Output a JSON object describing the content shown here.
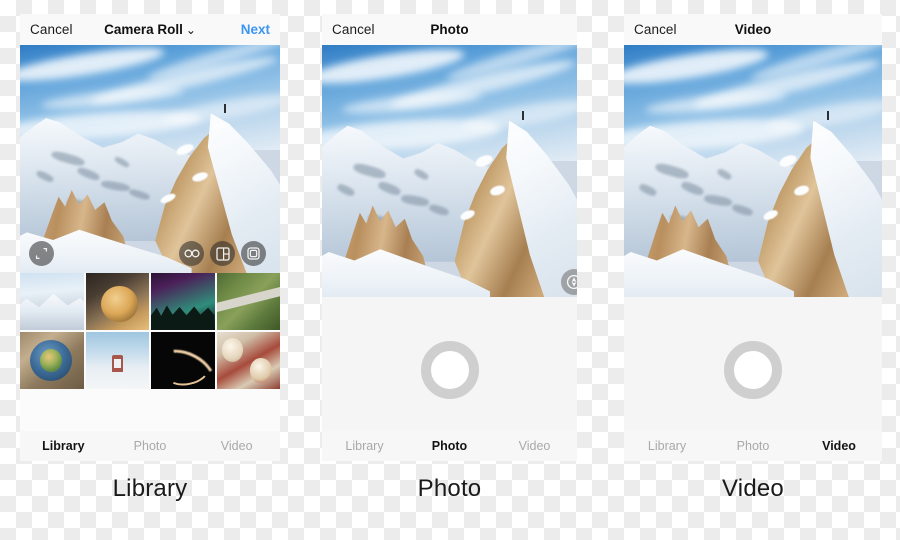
{
  "panels": [
    {
      "id": "library",
      "navbar": {
        "cancel_label": "Cancel",
        "title": "Camera Roll",
        "title_caret": "⌄",
        "next_label": "Next",
        "next_color": "#3c96f4"
      },
      "preview": {
        "alt": "snow-covered mountain peak with rocky outcrops under blue sky",
        "overlay_buttons": [
          {
            "name": "expand-icon",
            "label": "Expand"
          },
          {
            "name": "boomerang-infinity-icon",
            "label": "Boomerang"
          },
          {
            "name": "layout-icon",
            "label": "Layout"
          },
          {
            "name": "multi-select-icon",
            "label": "Select Multiple"
          }
        ]
      },
      "thumbnails": [
        {
          "name": "thumb-mountain",
          "label": "Snowy mountain"
        },
        {
          "name": "thumb-fried-food",
          "label": "Fried food on plate"
        },
        {
          "name": "thumb-aurora",
          "label": "Aurora over forest"
        },
        {
          "name": "thumb-aerial-path",
          "label": "Aerial path through field"
        },
        {
          "name": "thumb-salad-bowl",
          "label": "Salad bowl"
        },
        {
          "name": "thumb-bridge-fog",
          "label": "Bridge in fog"
        },
        {
          "name": "thumb-light-trail",
          "label": "Light trail at night"
        },
        {
          "name": "thumb-christmas",
          "label": "Christmas treats"
        }
      ],
      "tabs": [
        {
          "label": "Library",
          "active": true
        },
        {
          "label": "Photo",
          "active": false
        },
        {
          "label": "Video",
          "active": false
        }
      ],
      "caption": "Library"
    },
    {
      "id": "photo",
      "navbar": {
        "cancel_label": "Cancel",
        "title": "Photo",
        "title_caret": "",
        "next_label": "",
        "next_color": "#3c96f4"
      },
      "preview": {
        "alt": "snow-covered mountain peak with rocky outcrops under blue sky",
        "overlay_buttons": [
          {
            "name": "camera-flip-icon",
            "label": "Flip camera"
          }
        ]
      },
      "shutter": {
        "name": "shutter-button",
        "label": "Capture"
      },
      "tabs": [
        {
          "label": "Library",
          "active": false
        },
        {
          "label": "Photo",
          "active": true
        },
        {
          "label": "Video",
          "active": false
        }
      ],
      "caption": "Photo"
    },
    {
      "id": "video",
      "navbar": {
        "cancel_label": "Cancel",
        "title": "Video",
        "title_caret": "",
        "next_label": "",
        "next_color": "#3c96f4"
      },
      "preview": {
        "alt": "snow-covered mountain peak with rocky outcrops under blue sky",
        "overlay_buttons": []
      },
      "shutter": {
        "name": "record-button",
        "label": "Record"
      },
      "tabs": [
        {
          "label": "Library",
          "active": false
        },
        {
          "label": "Photo",
          "active": false
        },
        {
          "label": "Video",
          "active": true
        }
      ],
      "caption": "Video"
    }
  ]
}
